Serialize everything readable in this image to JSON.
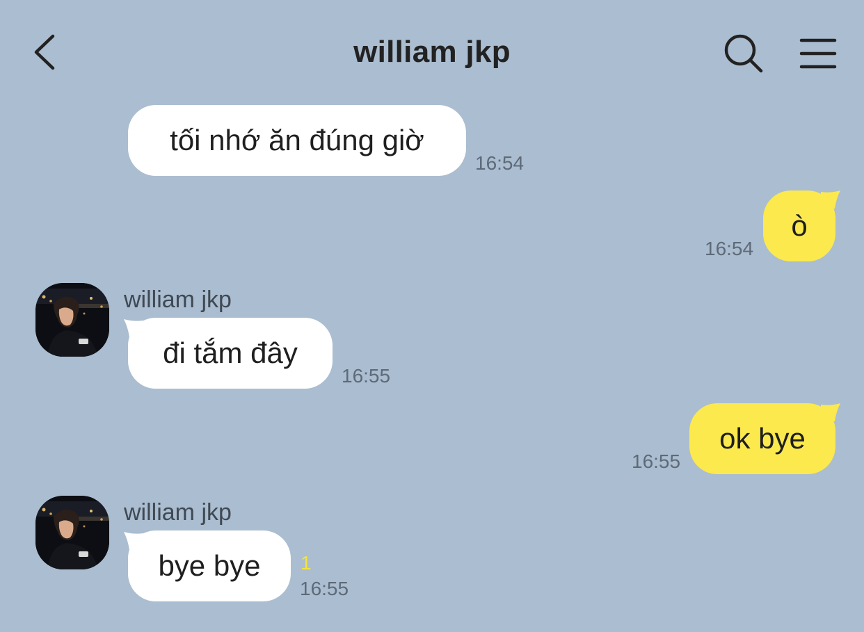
{
  "header": {
    "title": "william jkp",
    "back_icon": "chevron-left-icon",
    "search_icon": "search-icon",
    "menu_icon": "menu-icon"
  },
  "colors": {
    "background": "#abbdd0",
    "incoming_bubble": "#ffffff",
    "outgoing_bubble": "#fbe94e",
    "unread_badge": "#f5e33c",
    "timestamp": "#5e6a78"
  },
  "messages": [
    {
      "direction": "incoming",
      "text": "tối nhớ ăn đúng giờ",
      "time": "16:54"
    },
    {
      "direction": "outgoing",
      "text": "ò",
      "time": "16:54"
    },
    {
      "direction": "incoming",
      "sender": "william jkp",
      "text": "đi tắm đây",
      "time": "16:55"
    },
    {
      "direction": "outgoing",
      "text": "ok bye",
      "time": "16:55"
    },
    {
      "direction": "incoming",
      "sender": "william jkp",
      "text": "bye bye",
      "time": "16:55",
      "unread_count": "1"
    }
  ]
}
